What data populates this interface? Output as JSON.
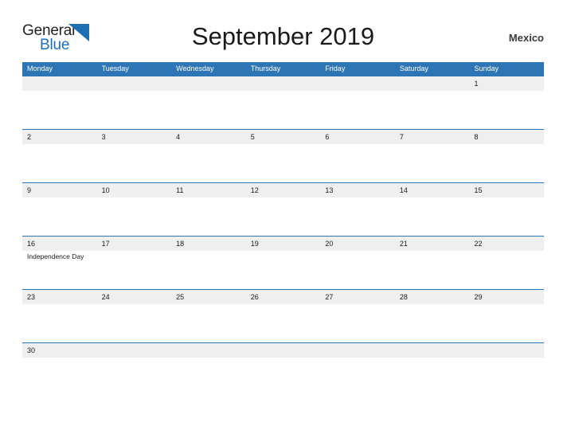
{
  "brand": {
    "name_part1": "General",
    "name_part2": "Blue",
    "logo_icon": "blue-triangle-icon",
    "color_dark": "#231f20",
    "color_blue": "#1f6fb5"
  },
  "header": {
    "title": "September 2019",
    "country": "Mexico"
  },
  "theme": {
    "header_bar": "#2e75b6",
    "row_band": "#efefef",
    "row_rule": "#2e75b6",
    "text": "#1a1a1a",
    "background": "#ffffff"
  },
  "calendar": {
    "month": "September",
    "year": "2019",
    "weekday_headers": [
      "Monday",
      "Tuesday",
      "Wednesday",
      "Thursday",
      "Friday",
      "Saturday",
      "Sunday"
    ],
    "weeks": [
      [
        {
          "date": "",
          "event": ""
        },
        {
          "date": "",
          "event": ""
        },
        {
          "date": "",
          "event": ""
        },
        {
          "date": "",
          "event": ""
        },
        {
          "date": "",
          "event": ""
        },
        {
          "date": "",
          "event": ""
        },
        {
          "date": "1",
          "event": ""
        }
      ],
      [
        {
          "date": "2",
          "event": ""
        },
        {
          "date": "3",
          "event": ""
        },
        {
          "date": "4",
          "event": ""
        },
        {
          "date": "5",
          "event": ""
        },
        {
          "date": "6",
          "event": ""
        },
        {
          "date": "7",
          "event": ""
        },
        {
          "date": "8",
          "event": ""
        }
      ],
      [
        {
          "date": "9",
          "event": ""
        },
        {
          "date": "10",
          "event": ""
        },
        {
          "date": "11",
          "event": ""
        },
        {
          "date": "12",
          "event": ""
        },
        {
          "date": "13",
          "event": ""
        },
        {
          "date": "14",
          "event": ""
        },
        {
          "date": "15",
          "event": ""
        }
      ],
      [
        {
          "date": "16",
          "event": "Independence Day"
        },
        {
          "date": "17",
          "event": ""
        },
        {
          "date": "18",
          "event": ""
        },
        {
          "date": "19",
          "event": ""
        },
        {
          "date": "20",
          "event": ""
        },
        {
          "date": "21",
          "event": ""
        },
        {
          "date": "22",
          "event": ""
        }
      ],
      [
        {
          "date": "23",
          "event": ""
        },
        {
          "date": "24",
          "event": ""
        },
        {
          "date": "25",
          "event": ""
        },
        {
          "date": "26",
          "event": ""
        },
        {
          "date": "27",
          "event": ""
        },
        {
          "date": "28",
          "event": ""
        },
        {
          "date": "29",
          "event": ""
        }
      ],
      [
        {
          "date": "30",
          "event": ""
        },
        {
          "date": "",
          "event": ""
        },
        {
          "date": "",
          "event": ""
        },
        {
          "date": "",
          "event": ""
        },
        {
          "date": "",
          "event": ""
        },
        {
          "date": "",
          "event": ""
        },
        {
          "date": "",
          "event": ""
        }
      ]
    ]
  }
}
